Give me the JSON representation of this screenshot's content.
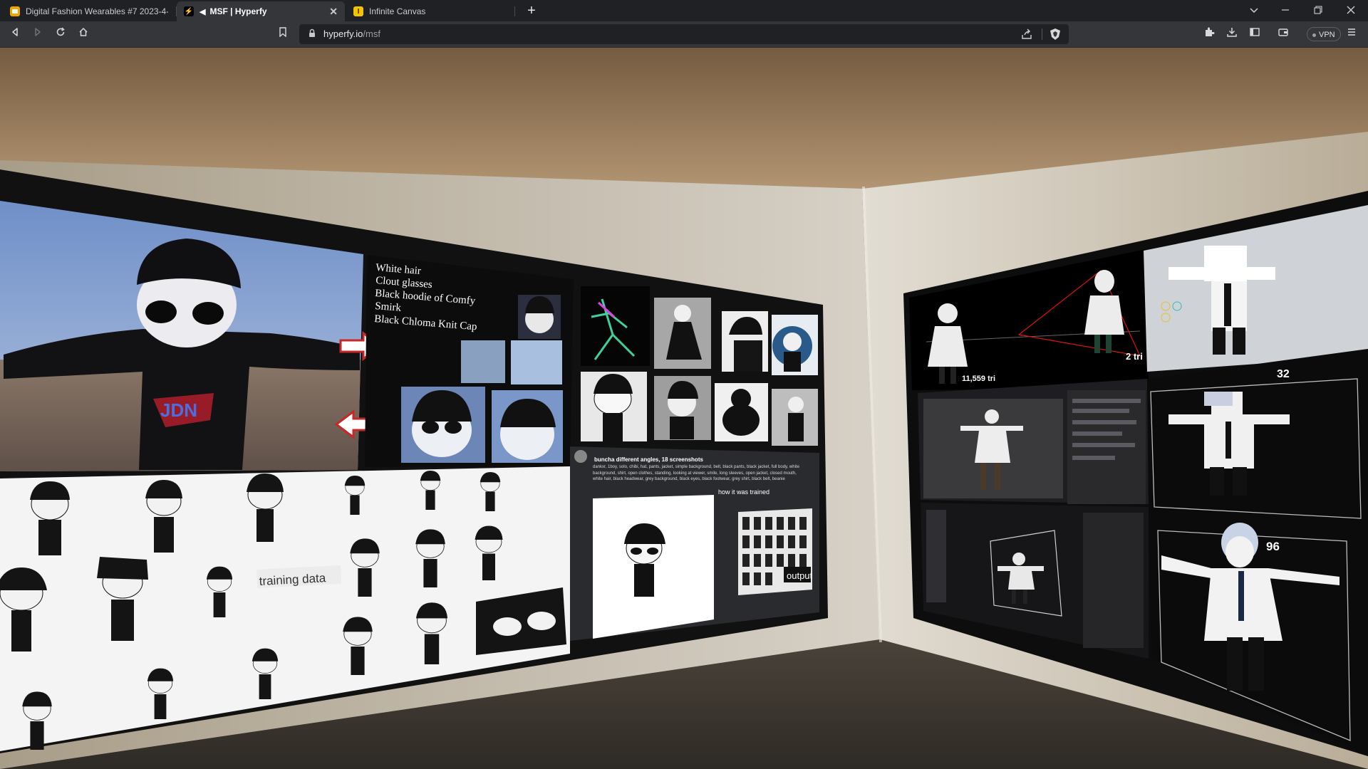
{
  "browser": {
    "tabs": [
      {
        "title": "Digital Fashion Wearables #7 2023-4-",
        "favicon": "slides-icon",
        "favicon_color": "#f2a600",
        "active": false
      },
      {
        "title": "MSF | Hyperfy",
        "favicon": "hyperfy-icon",
        "favicon_color": "#ffffff",
        "active": true,
        "audio": true
      },
      {
        "title": "Infinite Canvas",
        "favicon": "canvas-icon",
        "favicon_color": "#f5c400",
        "active": false
      }
    ],
    "url_host": "hyperfy.io",
    "url_path": "/msf",
    "vpn_label": "VPN"
  },
  "scene": {
    "left_wall": {
      "notes": [
        "White hair",
        "Clout glasses",
        "Black hoodie of Comfy",
        "Smirk",
        "Black Chloma Knit Cap"
      ],
      "training_label": "training data",
      "chat_header": "buncha different angles, 18 screenshots",
      "chat_body": "dankxr, 1boy, solo, chibi, hat, pants, jacket, simple background, belt, black pants, black jacket, full body, white background, shirt, open clothes, standing, looking at viewer, smile, long sleeves, open jacket, closed mouth, white hair, black headwear, grey background, black eyes, black footwear, grey shirt, black belt, beanie",
      "trained_label": "how it was trained",
      "output_label": "output"
    },
    "right_wall": {
      "tri_count": "11,559 tri",
      "tri_small": "2 tri",
      "res_a": "32",
      "res_b": "96"
    }
  },
  "colors": {
    "tab_bg": "#202124",
    "toolbar_bg": "#35363a",
    "wall": "#b5a994",
    "ceiling": "#8d7050",
    "floor": "#3b352d"
  }
}
